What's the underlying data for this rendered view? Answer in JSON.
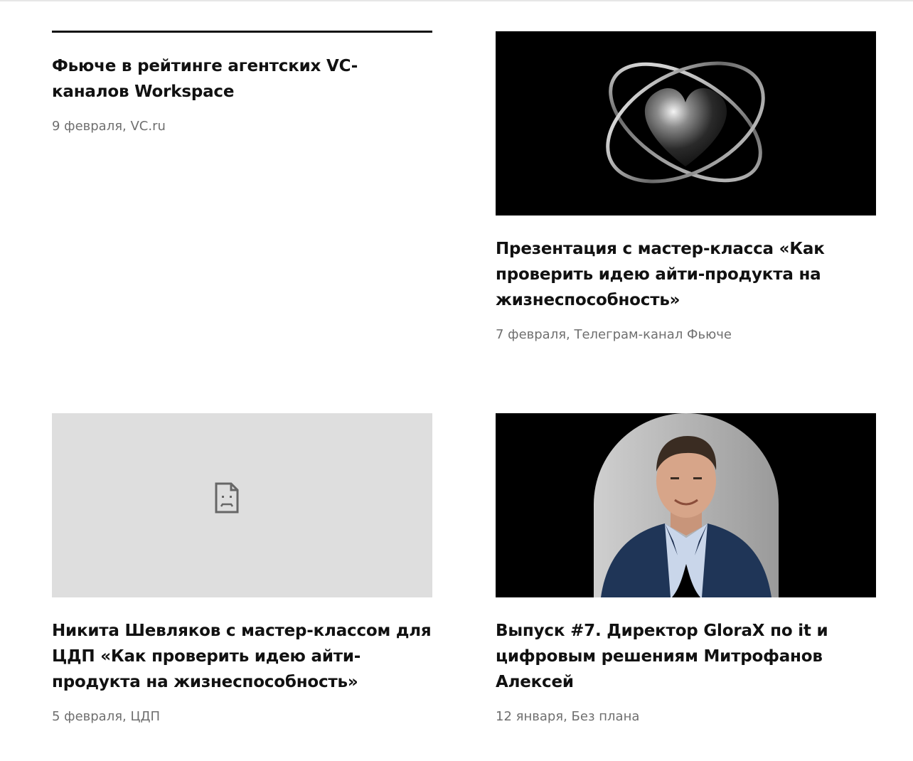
{
  "articles": [
    {
      "title": "Фьюче в рейтинге агентских VC-каналов Workspace",
      "meta": "9 февраля, VC.ru"
    },
    {
      "title": "Презентация с мастер-класса «Как проверить идею айти-продукта на жизнеспособность»",
      "meta": "7 февраля, Телеграм-канал Фьюче",
      "image": "heart-with-rings-image"
    },
    {
      "title": "Никита Шевляков с мастер-классом для ЦДП «Как проверить идею айти-продукта на жизнеспособность»",
      "meta": "5 февраля, ЦДП",
      "image": "broken-image-icon"
    },
    {
      "title": "Выпуск #7. Директор GloraX по it и цифровым решениям Митрофанов Алексей",
      "meta": "12 января, Без плана",
      "image": "speaker-portrait-image"
    }
  ],
  "colors": {
    "text": "#111111",
    "meta": "#6f6f6f",
    "placeholder": "#dedede",
    "image_bg": "#000000"
  }
}
